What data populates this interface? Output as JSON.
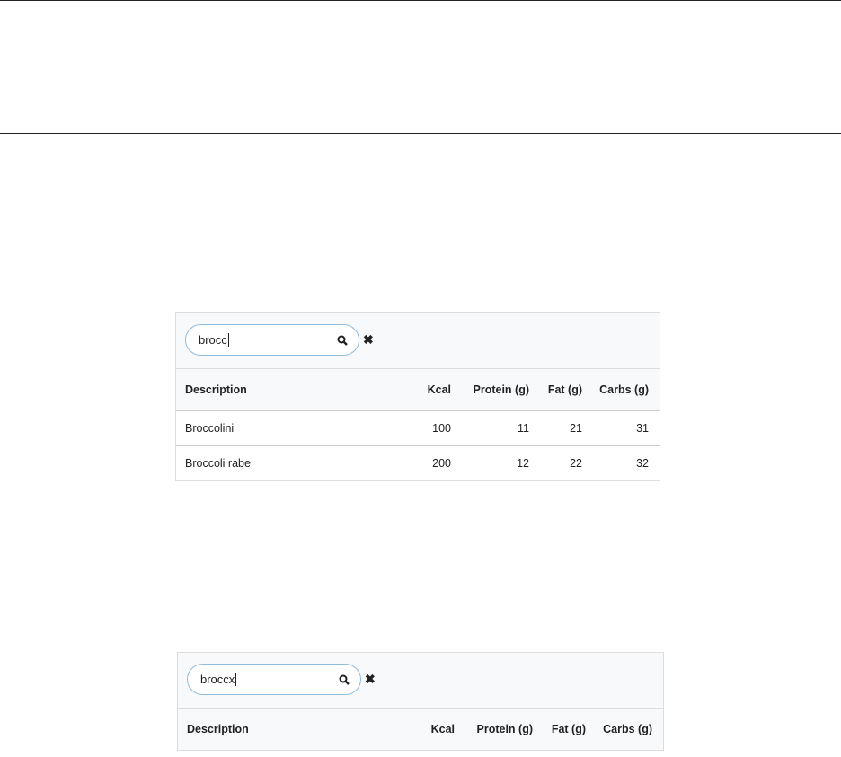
{
  "columns": [
    "Description",
    "Kcal",
    "Protein (g)",
    "Fat (g)",
    "Carbs (g)"
  ],
  "example1": {
    "search_value": "brocc",
    "rows": [
      {
        "description": "Broccolini",
        "kcal": "100",
        "protein": "11",
        "fat": "21",
        "carbs": "31"
      },
      {
        "description": "Broccoli rabe",
        "kcal": "200",
        "protein": "12",
        "fat": "22",
        "carbs": "32"
      }
    ]
  },
  "example2": {
    "search_value": "broccx",
    "rows": []
  },
  "icons": {
    "search": "search-icon",
    "clear": "close-icon"
  }
}
